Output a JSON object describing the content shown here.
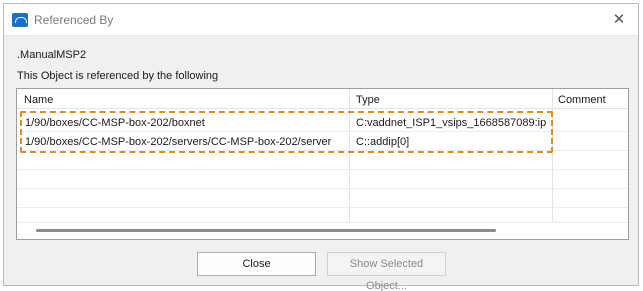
{
  "window": {
    "title": "Referenced By",
    "close_glyph": "✕",
    "icon": "app-window-icon"
  },
  "object_name": ".ManualMSP2",
  "description": "This Object is referenced by the following",
  "table": {
    "columns": [
      "Name",
      "Type",
      "Comment"
    ],
    "rows": [
      {
        "name": "1/90/boxes/CC-MSP-box-202/boxnet",
        "type": "C:vaddnet_ISP1_vsips_1668587089:ip",
        "comment": ""
      },
      {
        "name": "1/90/boxes/CC-MSP-box-202/servers/CC-MSP-box-202/server",
        "type": "C::addip[0]",
        "comment": ""
      }
    ]
  },
  "buttons": {
    "close": "Close",
    "show_selected": "Show Selected Object..."
  },
  "colors": {
    "highlight": "#e8891c",
    "accent": "#1a6fc9"
  }
}
